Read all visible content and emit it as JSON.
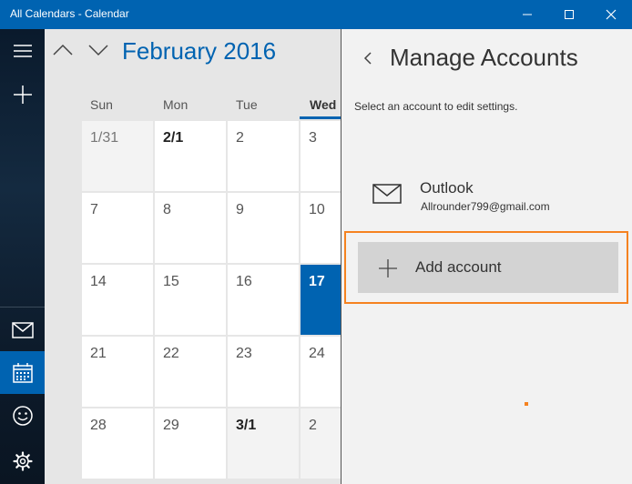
{
  "window": {
    "title": "All Calendars - Calendar",
    "controls": [
      "minimize-icon",
      "maximize-icon",
      "close-icon"
    ]
  },
  "sidebar": {
    "top_items": [
      {
        "icon": "hamburger-menu-icon"
      },
      {
        "icon": "plus-icon"
      }
    ],
    "bottom_items": [
      {
        "icon": "mail-icon"
      },
      {
        "icon": "calendar-icon",
        "active": true
      },
      {
        "icon": "smiley-icon"
      },
      {
        "icon": "gear-icon"
      }
    ],
    "accent": "#0063b1"
  },
  "calendar": {
    "month_title": "February 2016",
    "day_headers": [
      "Sun",
      "Mon",
      "Tue",
      "Wed"
    ],
    "weeks": [
      [
        "1/31",
        "2/1",
        "2",
        "3"
      ],
      [
        "7",
        "8",
        "9",
        "10"
      ],
      [
        "14",
        "15",
        "16",
        "17"
      ],
      [
        "21",
        "22",
        "23",
        "24"
      ],
      [
        "28",
        "29",
        "3/1",
        "2"
      ]
    ],
    "today": "17"
  },
  "panel": {
    "title": "Manage Accounts",
    "subtitle": "Select an account to edit settings.",
    "account": {
      "name": "Outlook",
      "email": "Allrounder799@gmail.com",
      "icon": "mail-icon"
    },
    "add_account_label": "Add account",
    "highlight_color": "#f58220"
  }
}
